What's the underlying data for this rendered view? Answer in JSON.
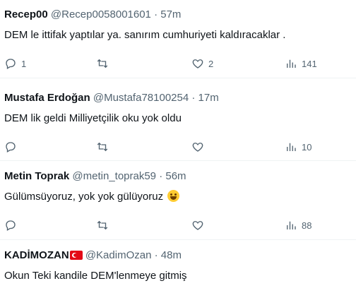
{
  "tweets": [
    {
      "name": "Recep00",
      "handle": "@Recep0058001601",
      "dot": "·",
      "time": "57m",
      "text": "DEM le ittifak yaptılar ya. sanırım cumhuriyeti kaldıracaklar .",
      "replies": "1",
      "retweets": "",
      "likes": "2",
      "views": "141"
    },
    {
      "name": "Mustafa Erdoğan",
      "handle": "@Mustafa78100254",
      "dot": "·",
      "time": "17m",
      "text": "DEM lik geldi Milliyetçilik oku yok oldu",
      "replies": "",
      "retweets": "",
      "likes": "",
      "views": "10"
    },
    {
      "name": "Metin Toprak",
      "handle": "@metin_toprak59",
      "dot": "·",
      "time": "56m",
      "text": "Gülümsüyoruz, yok yok gülüyoruz",
      "emoji": "rolling-on-floor-laughing-icon",
      "replies": "",
      "retweets": "",
      "likes": "",
      "views": "88"
    },
    {
      "name": "KADİMOZAN",
      "flag": "turkey-flag-icon",
      "handle": "@KadimOzan",
      "dot": "·",
      "time": "48m",
      "text": "Okun Teki kandile DEM'lenmeye gitmiş"
    }
  ]
}
